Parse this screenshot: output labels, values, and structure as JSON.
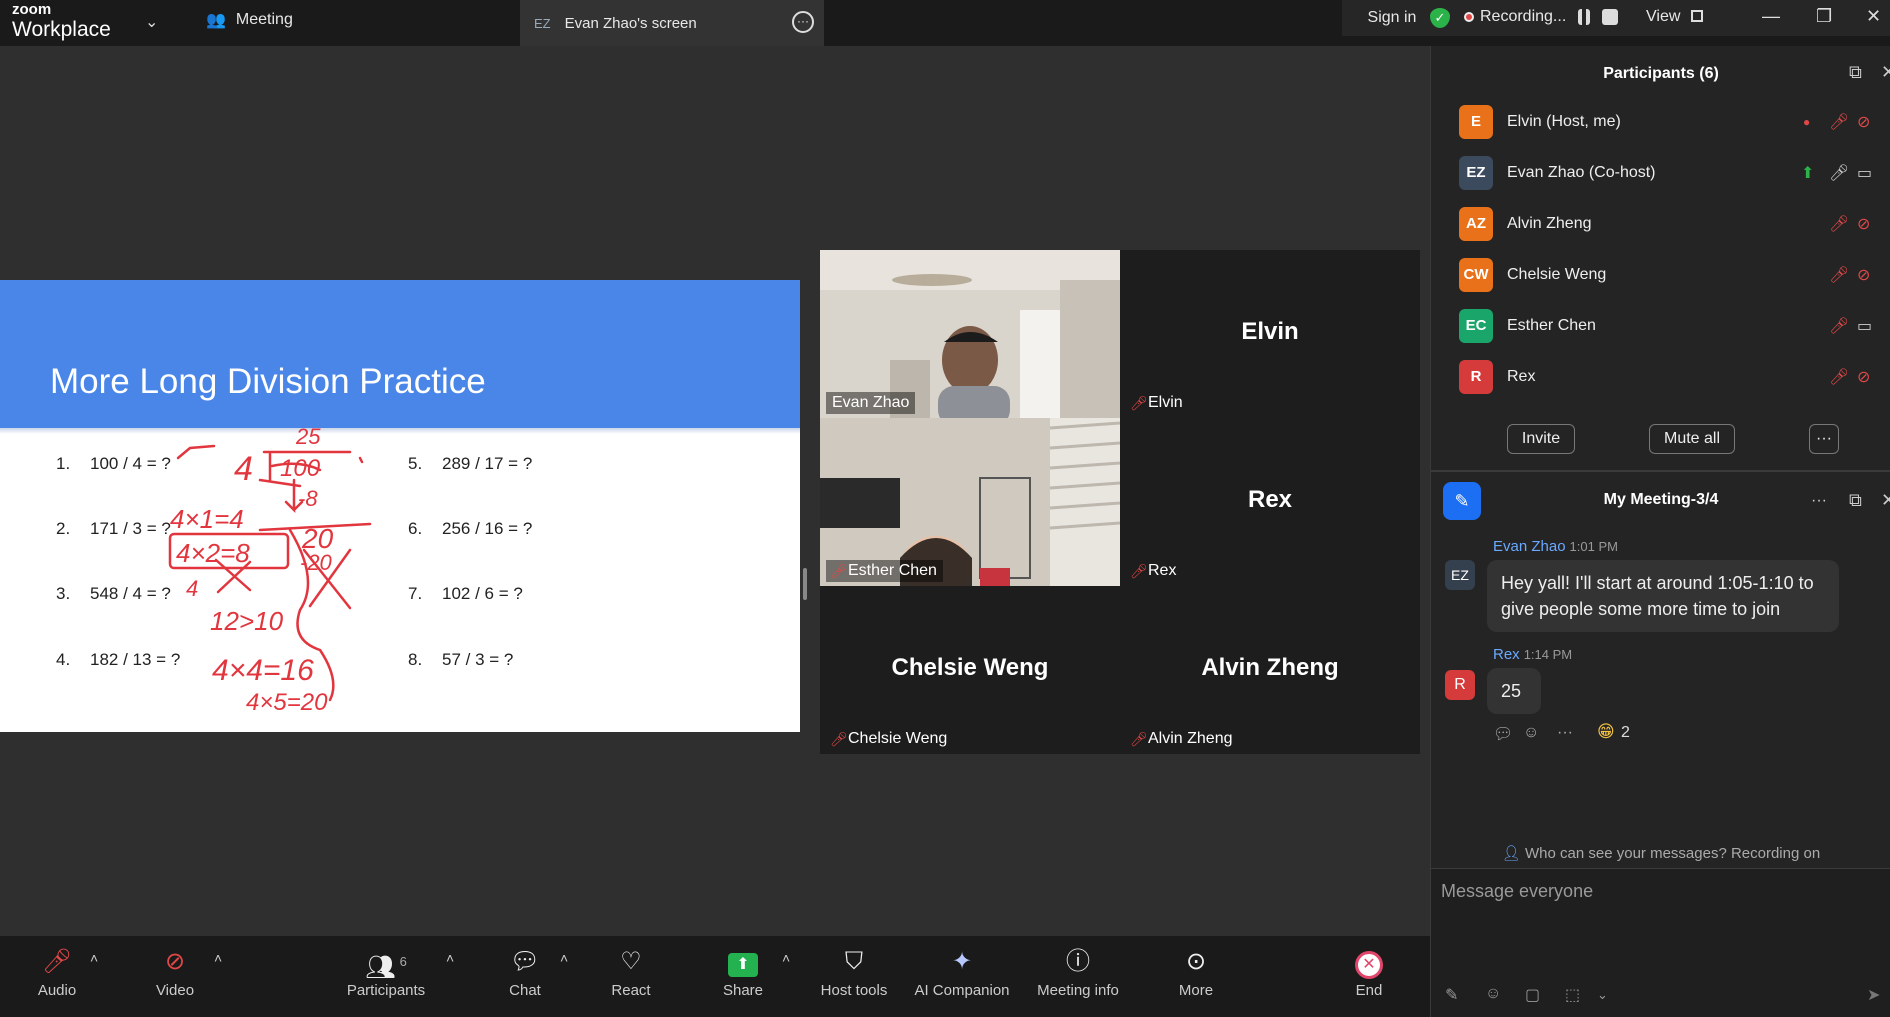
{
  "topbar": {
    "brand_top": "zoom",
    "brand_bottom": "Workplace",
    "meeting_label": "Meeting",
    "screen_initials": "EZ",
    "screen_label": "Evan Zhao's screen",
    "sign_in": "Sign in",
    "recording_label": "Recording...",
    "view_label": "View"
  },
  "slide": {
    "title": "More Long Division Practice",
    "problems": [
      {
        "n": "1.",
        "text": "100 / 4 = ?"
      },
      {
        "n": "2.",
        "text": "171 / 3 = ?"
      },
      {
        "n": "3.",
        "text": "548 / 4 = ?"
      },
      {
        "n": "4.",
        "text": "182 / 13 = ?"
      },
      {
        "n": "5.",
        "text": "289 / 17 = ?"
      },
      {
        "n": "6.",
        "text": "256 / 16 = ?"
      },
      {
        "n": "7.",
        "text": "102 / 6 = ?"
      },
      {
        "n": "8.",
        "text": "57 / 3 = ?"
      }
    ],
    "ink": [
      "25",
      "4",
      "100",
      "-8",
      "4×1=4",
      "20",
      "4×2=8",
      "-20",
      "4",
      "12>10",
      "4×4=16",
      "4×5=20"
    ]
  },
  "gallery": {
    "tiles": [
      {
        "label": "Evan Zhao",
        "big": ""
      },
      {
        "label": "Elvin",
        "big": "Elvin"
      },
      {
        "label": "Esther Chen",
        "big": ""
      },
      {
        "label": "Rex",
        "big": "Rex"
      },
      {
        "label": "Chelsie Weng",
        "big": "Chelsie Weng"
      },
      {
        "label": "Alvin Zheng",
        "big": "Alvin Zheng"
      }
    ]
  },
  "participants": {
    "title": "Participants (6)",
    "list": [
      {
        "initials": "E",
        "name": "Elvin (Host, me)",
        "color": "#e8711a"
      },
      {
        "initials": "EZ",
        "name": "Evan Zhao (Co-host)",
        "color": "#3c4a5e"
      },
      {
        "initials": "AZ",
        "name": "Alvin Zheng",
        "color": "#e8711a"
      },
      {
        "initials": "CW",
        "name": "Chelsie Weng",
        "color": "#e8711a"
      },
      {
        "initials": "EC",
        "name": "Esther Chen",
        "color": "#1aa66a"
      },
      {
        "initials": "R",
        "name": "Rex",
        "color": "#d63b3b"
      }
    ],
    "invite": "Invite",
    "mute_all": "Mute all"
  },
  "chat": {
    "title": "My Meeting-3/4",
    "messages": [
      {
        "initials": "EZ",
        "sender": "Evan Zhao",
        "time": "1:01 PM",
        "text": "Hey yall! I'll start at around 1:05-1:10 to give people some more time to join"
      },
      {
        "initials": "R",
        "sender": "Rex",
        "time": "1:14 PM",
        "text": "25"
      }
    ],
    "reaction_count": "2",
    "visibility": "Who can see your messages? Recording on",
    "placeholder": "Message everyone"
  },
  "toolbar": {
    "audio": "Audio",
    "video": "Video",
    "participants": "Participants",
    "participants_count": "6",
    "chat": "Chat",
    "react": "React",
    "share": "Share",
    "host_tools": "Host tools",
    "ai": "AI Companion",
    "info": "Meeting info",
    "more": "More",
    "end": "End"
  }
}
